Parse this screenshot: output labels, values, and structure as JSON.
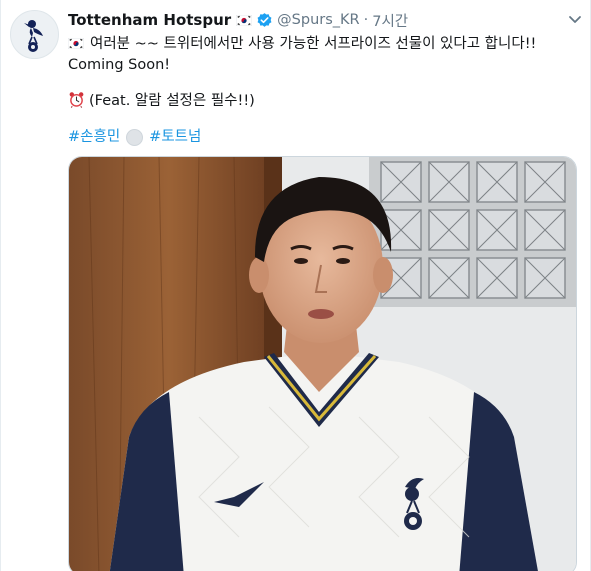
{
  "tweet": {
    "display_name": "Tottenham Hotspur",
    "handle": "@Spurs_KR",
    "separator": "·",
    "time": "7시간",
    "line1": "여러분 ~~ 트위터에서만 사용 가능한 서프라이즈 선물이 있다고 합니다!!",
    "line2": "Coming Soon!",
    "line3": "(Feat. 알람 설정은 필수!!)",
    "hashtag1": "#손흥민",
    "hashtag2": "#토트넘"
  },
  "icons": {
    "flag": "south-korea-flag-icon",
    "verified": "verified-badge-icon",
    "more": "chevron-down-icon",
    "alarm": "alarm-clock-icon",
    "hashtag_emoji": "soccer-ball-icon"
  },
  "colors": {
    "link": "#1b95e0",
    "secondary_text": "#657786",
    "verified": "#1da1f2"
  }
}
